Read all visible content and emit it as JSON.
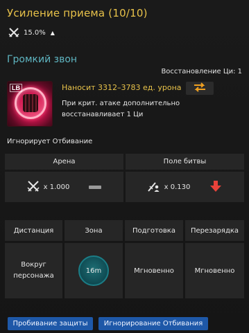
{
  "title": "Усиление приема (10/10)",
  "bonus": {
    "icon": "crossed-swords-icon",
    "value": "15.0%",
    "trend_icon": "arrow-up-icon"
  },
  "skill": {
    "name": "Громкий звон",
    "cooldown_text": "Восстановление Ци: 1",
    "icon_badge": "LB",
    "damage_text": "Наносит 3312–3783 ед. урона",
    "swap_icon": "swap-arrows-icon",
    "crit_text": "При крит. атаке дополнительно восстанавливает 1 Ци",
    "ignore_text": "Игнорирует Отбивание"
  },
  "modes": {
    "arena": {
      "label": "Арена",
      "value": "x 1.000",
      "icon": "crossed-swords-icon",
      "change_icon": "dash-icon"
    },
    "field": {
      "label": "Поле битвы",
      "value": "x 0.130",
      "icon": "sword-person-icon",
      "change_icon": "arrow-down-icon"
    }
  },
  "stats": {
    "headers": [
      "Дистанция",
      "Зона",
      "Подготовка",
      "Перезарядка"
    ],
    "range": "Вокруг персонажа",
    "zone": "16m",
    "cast": "Мгновенно",
    "cooldown": "Мгновенно"
  },
  "tags": [
    "Пробивание защиты",
    "Игнорирование Отбивания"
  ],
  "colors": {
    "title": "#e8c24a",
    "skill_name": "#5fb6c2",
    "tag_bg": "#1e58a8",
    "down_arrow": "#e8423a",
    "swap_icon": "#f0a020"
  }
}
